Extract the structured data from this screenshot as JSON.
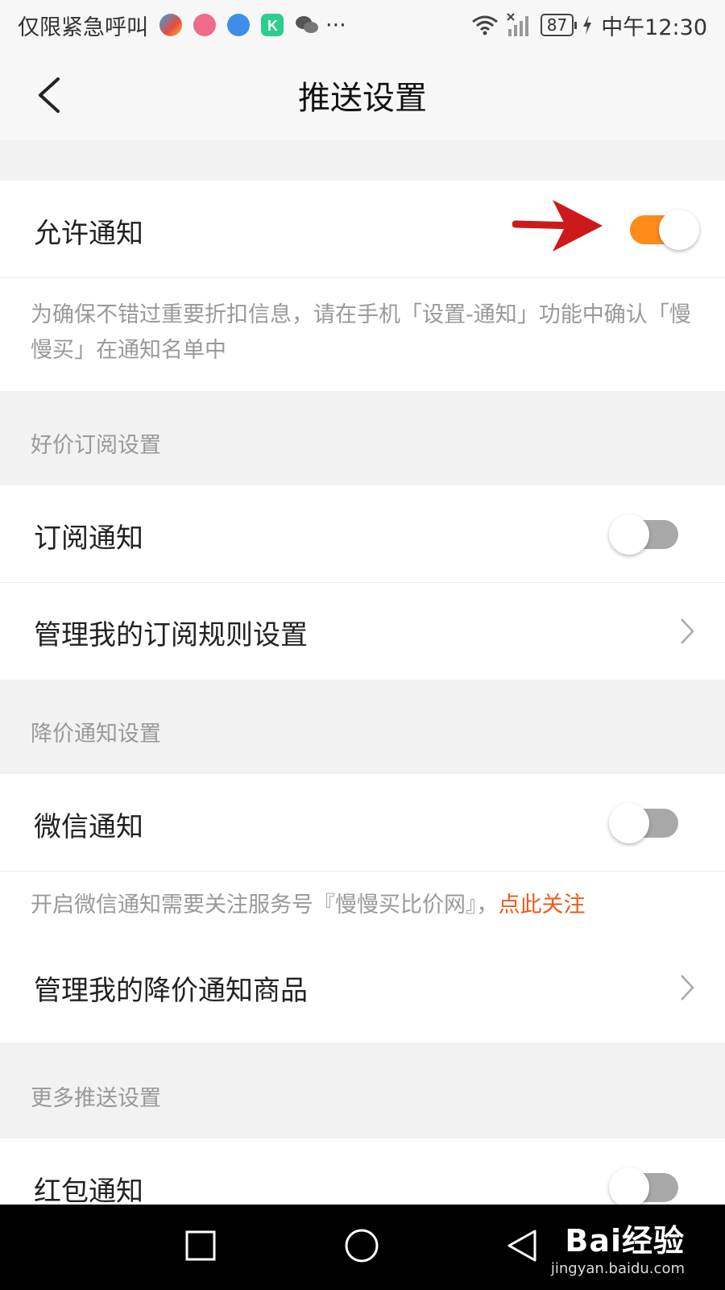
{
  "status_bar": {
    "carrier_text": "仅限紧急呼叫",
    "more": "···",
    "battery": "87",
    "time": "中午12:30",
    "icons": [
      "app-browser-icon",
      "app-piggy-icon",
      "app-globe-icon",
      "app-k-icon",
      "wechat-icon",
      "wifi-icon",
      "signal-icon",
      "charging-icon"
    ]
  },
  "nav": {
    "title": "推送设置",
    "back_icon": "chevron-left-icon"
  },
  "allow_notify": {
    "label": "允许通知",
    "enabled": true,
    "hint": "为确保不错过重要折扣信息，请在手机「设置-通知」功能中确认「慢慢买」在通知名单中"
  },
  "deal_section": {
    "title": "好价订阅设置",
    "subscribe": {
      "label": "订阅通知",
      "enabled": false
    },
    "manage_rules": {
      "label": "管理我的订阅规则设置"
    }
  },
  "price_drop_section": {
    "title": "降价通知设置",
    "wechat": {
      "label": "微信通知",
      "enabled": false
    },
    "wechat_hint": "开启微信通知需要关注服务号『慢慢买比价网』，",
    "wechat_link": "点此关注",
    "manage_goods": {
      "label": "管理我的降价通知商品"
    }
  },
  "more_section": {
    "title": "更多推送设置",
    "red_packet": {
      "label": "红包通知",
      "enabled": false
    }
  },
  "watermark": {
    "brand": "Bai经验",
    "url": "jingyan.baidu.com"
  },
  "colors": {
    "accent": "#fe8b1b",
    "link": "#ee5a1b",
    "annotation_arrow": "#cc1a1a"
  }
}
